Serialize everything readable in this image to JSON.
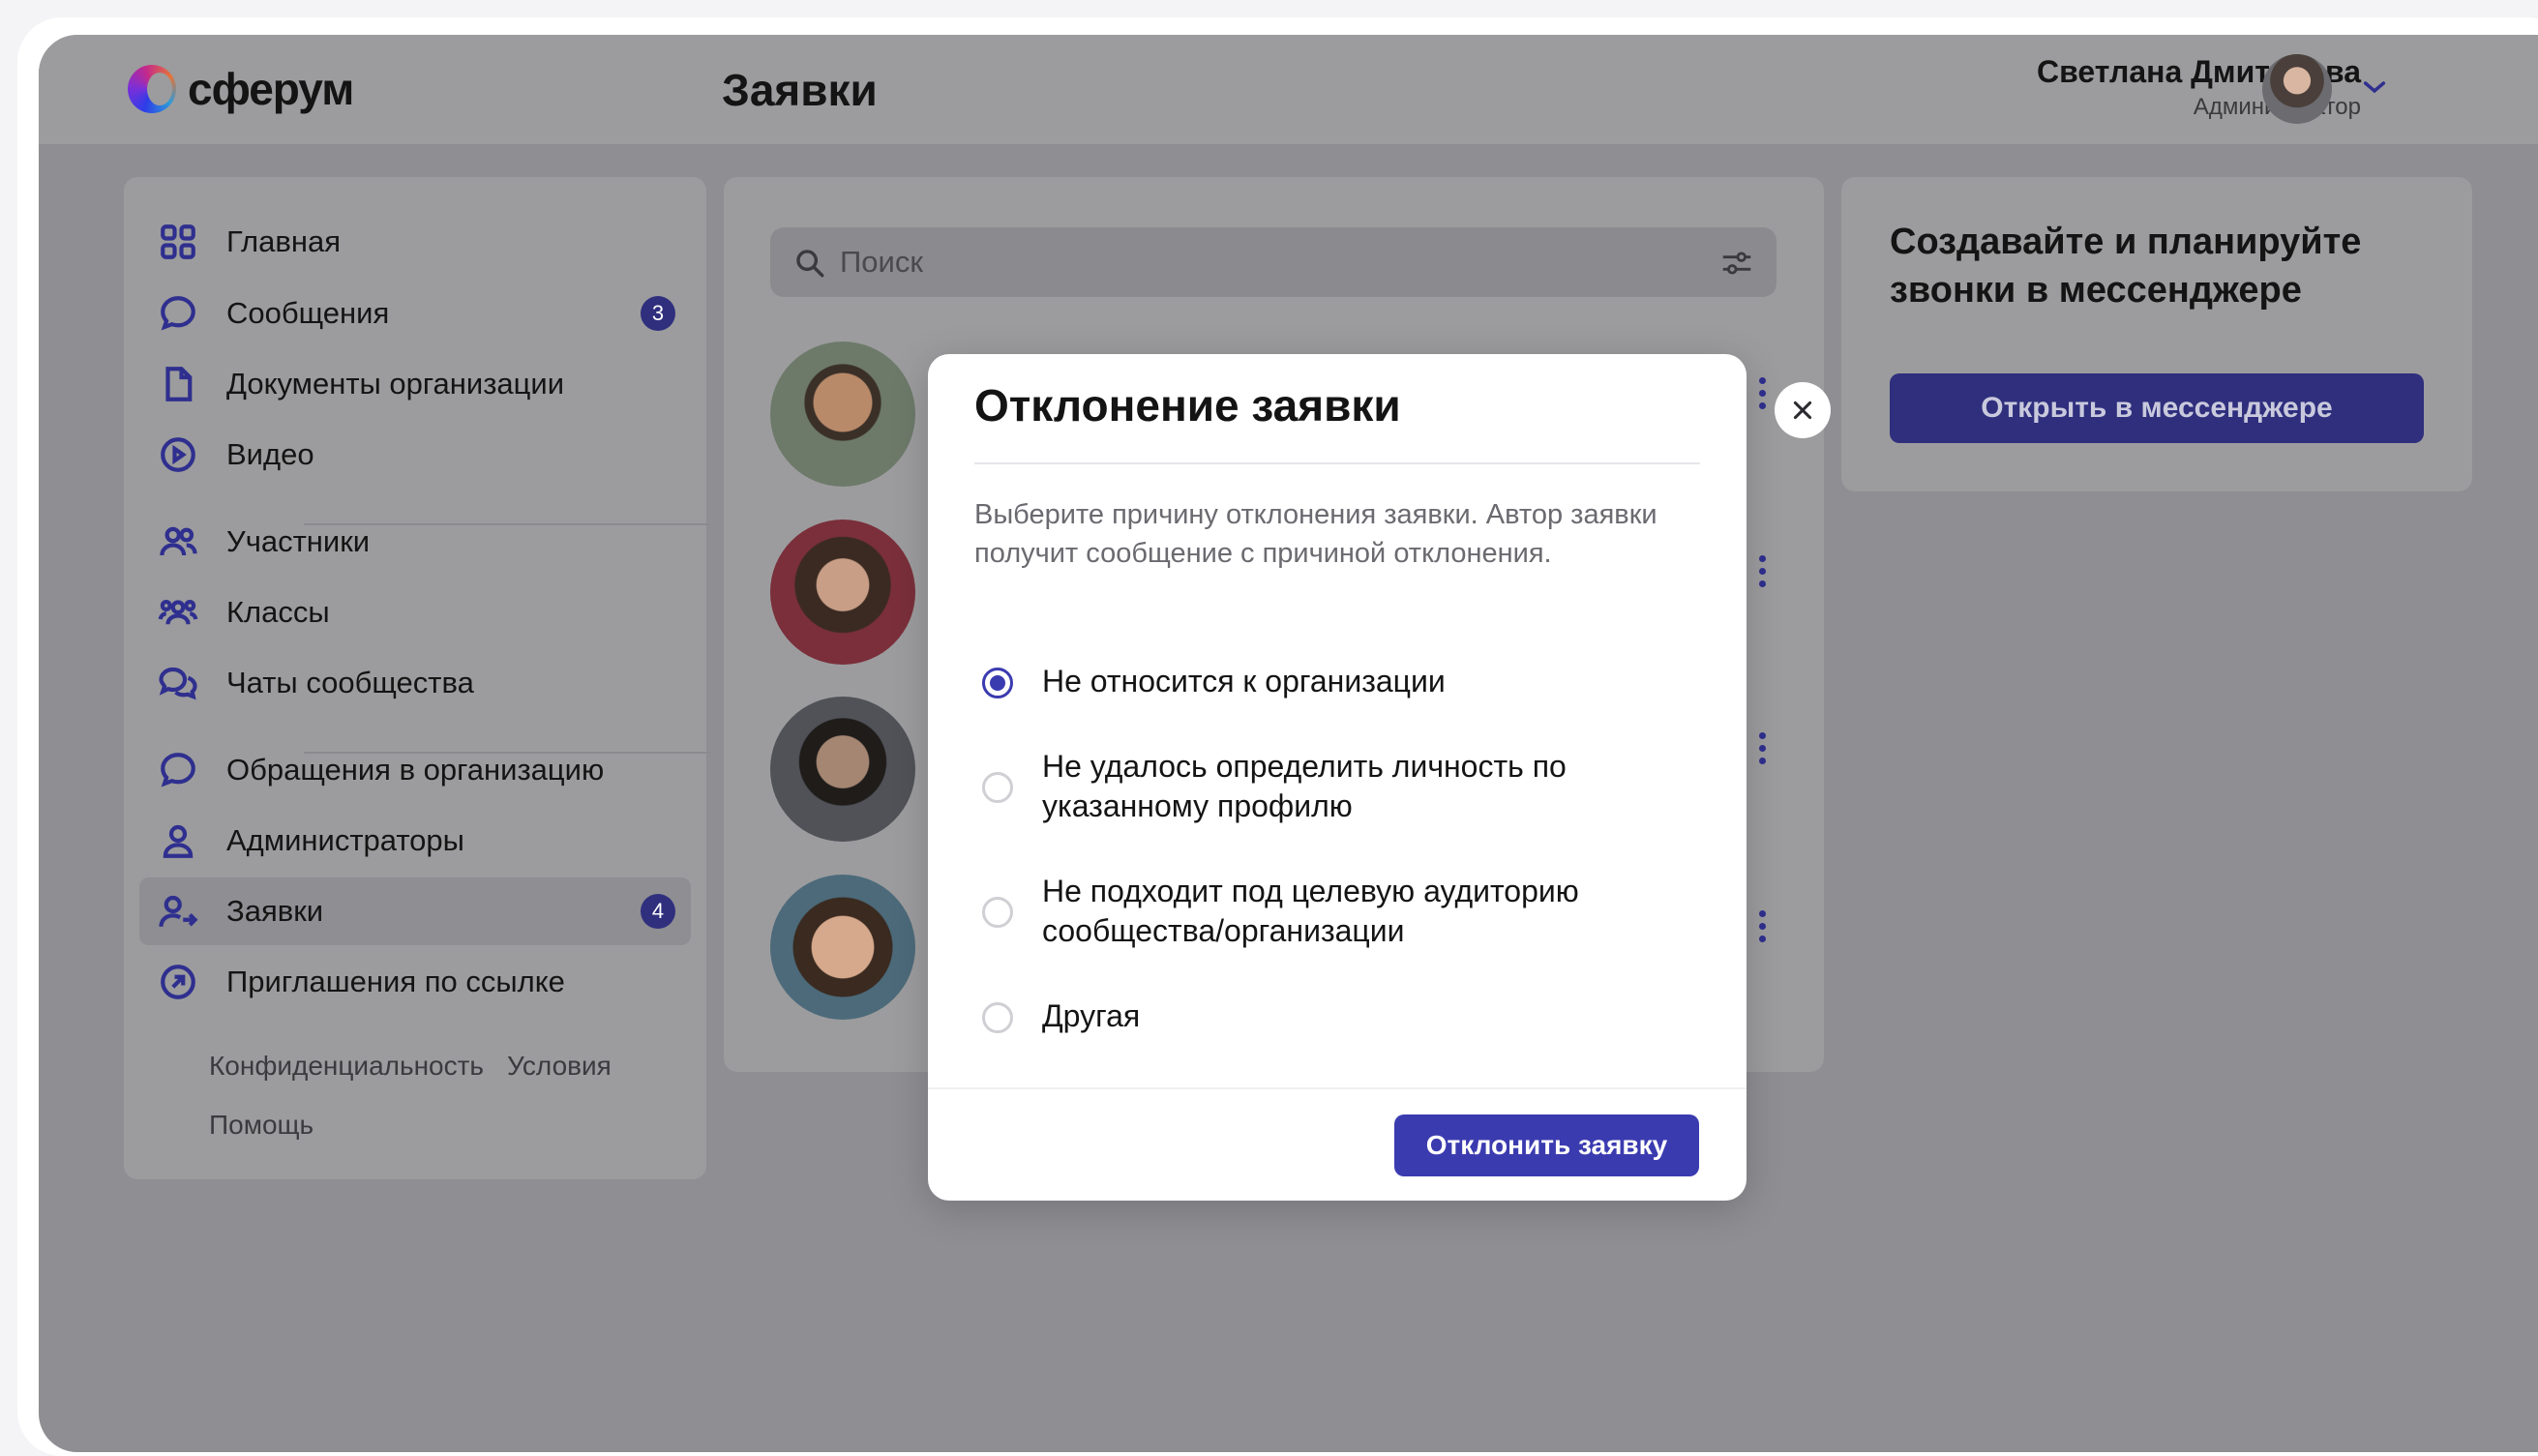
{
  "app": {
    "logo_text": "сферум",
    "page_title": "Заявки"
  },
  "user": {
    "name": "Светлана Дмитриева",
    "role": "Администратор"
  },
  "sidebar": {
    "items": [
      {
        "label": "Главная",
        "icon": "grid-icon"
      },
      {
        "label": "Сообщения",
        "icon": "chat-icon",
        "badge": "3"
      },
      {
        "label": "Документы организации",
        "icon": "document-icon"
      },
      {
        "label": "Видео",
        "icon": "play-icon"
      },
      {
        "label": "Участники",
        "icon": "users-icon"
      },
      {
        "label": "Классы",
        "icon": "group-icon"
      },
      {
        "label": "Чаты сообщества",
        "icon": "chats-icon"
      },
      {
        "label": "Обращения в организацию",
        "icon": "chat-icon"
      },
      {
        "label": "Администраторы",
        "icon": "person-icon"
      },
      {
        "label": "Заявки",
        "icon": "user-arrow-icon",
        "badge": "4",
        "active": true
      },
      {
        "label": "Приглашения по ссылке",
        "icon": "link-arrow-icon"
      }
    ],
    "footer": {
      "privacy": "Конфиденциальность",
      "terms": "Условия",
      "help": "Помощь"
    }
  },
  "search": {
    "placeholder": "Поиск"
  },
  "promo": {
    "title": "Создавайте и планируйте звонки в мессенджере",
    "button": "Открыть в мессенджере"
  },
  "modal": {
    "title": "Отклонение заявки",
    "description": "Выберите причину отклонения заявки. Автор заявки получит сообщение с причиной отклонения.",
    "options": [
      {
        "label": "Не относится к организации",
        "selected": true
      },
      {
        "label": "Не удалось определить личность по указанному профилю",
        "selected": false
      },
      {
        "label": "Не подходит под целевую аудиторию сообщества/организации",
        "selected": false
      },
      {
        "label": "Другая",
        "selected": false
      }
    ],
    "submit": "Отклонить заявку"
  },
  "colors": {
    "accent": "#3b3bb0",
    "badge": "#2f2f7e",
    "overlay": "#8e8e93"
  }
}
